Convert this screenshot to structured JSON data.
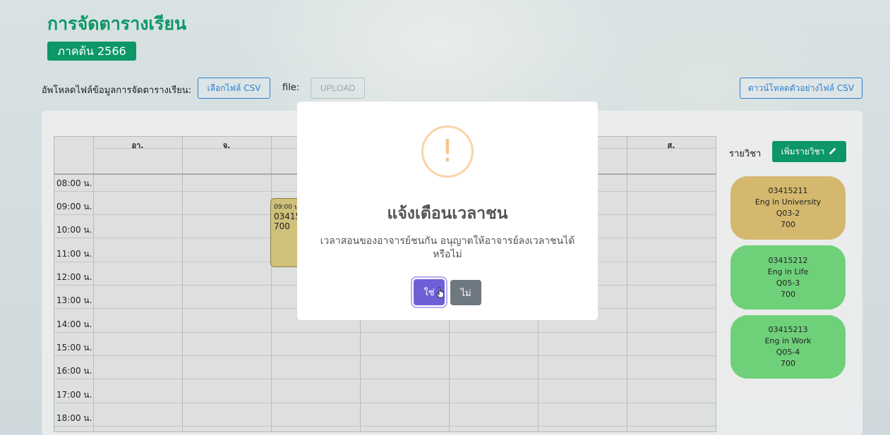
{
  "header": {
    "title": "การจัดตารางเรียน",
    "term": "ภาคต้น 2566"
  },
  "upload": {
    "label": "อัพโหลดไฟล์ข้อมูลการจัดตารางเรียน:",
    "choose_button": "เลือกไฟล์ CSV",
    "file_label": "file:",
    "upload_button": "UPLOAD",
    "download_sample_button": "ดาวน์โหลดตัวอย่างไฟล์ CSV"
  },
  "schedule": {
    "days": [
      "อา.",
      "จ.",
      "",
      "",
      "",
      "",
      "ส."
    ],
    "times": [
      "08:00 น.",
      "09:00 น.",
      "10:00 น.",
      "11:00 น.",
      "12:00 น.",
      "13:00 น.",
      "14:00 น.",
      "15:00 น.",
      "16:00 น.",
      "17:00 น.",
      "18:00 น."
    ],
    "event": {
      "time": "09:00 น",
      "code": "03415",
      "room": "700",
      "color": "#cfc07a"
    }
  },
  "courses": {
    "label": "รายวิชา",
    "add_button": "เพิ่มรายวิชา",
    "items": [
      {
        "code": "03415211",
        "name": "Eng in University",
        "section": "Q03-2",
        "room": "700",
        "color": "#d4b86e"
      },
      {
        "code": "03415212",
        "name": "Eng in Life",
        "section": "Q05-3",
        "room": "700",
        "color": "#6fd07a"
      },
      {
        "code": "03415213",
        "name": "Eng in Work",
        "section": "Q05-4",
        "room": "700",
        "color": "#6fd07a"
      }
    ]
  },
  "modal": {
    "icon_glyph": "!",
    "title": "แจ้งเตือนเวลาชน",
    "message": "เวลาสอนของอาจารย์ชนกัน อนุญาตให้อาจารย์ลงเวลาชนได้หรือไม่",
    "confirm": "ใช่",
    "cancel": "ไม่"
  },
  "colors": {
    "brand": "#0d9767",
    "confirm": "#6e5fd6",
    "cancel": "#6e7881",
    "warning": "#f8d4a6"
  }
}
